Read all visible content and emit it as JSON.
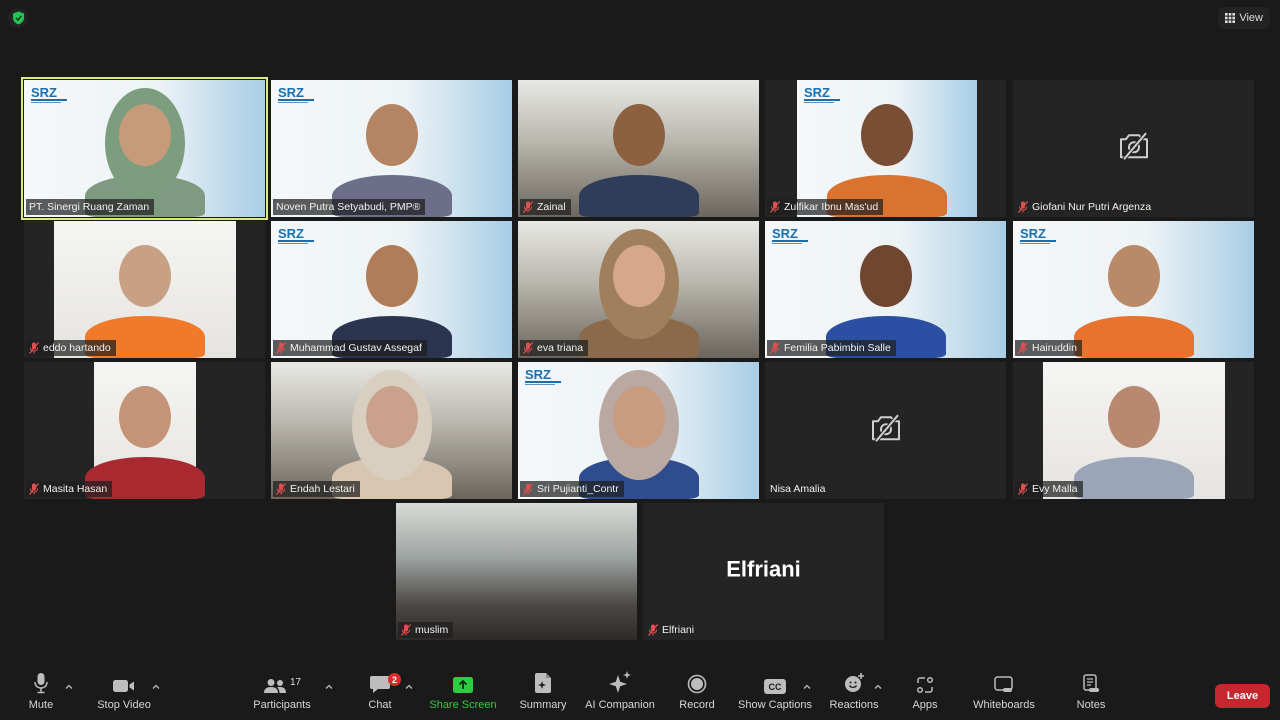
{
  "app": {
    "security_icon": "shield-check-icon",
    "view_button": {
      "label": "View",
      "icon": "grid-icon"
    }
  },
  "colors": {
    "active_speaker_border": "#d9ea7a",
    "muted_mic": "#e05050",
    "share_screen": "#2ecc40",
    "leave": "#c6262e",
    "badge": "#e02a2a"
  },
  "participants": [
    {
      "name": "PT. Sinergi Ruang Zaman",
      "muted": false,
      "video": true,
      "active": true,
      "background": "srz"
    },
    {
      "name": "Noven Putra Setyabudi, PMP®",
      "muted": false,
      "video": true,
      "active": false,
      "background": "srz"
    },
    {
      "name": "Zainal",
      "muted": true,
      "video": true,
      "active": false,
      "background": "office"
    },
    {
      "name": "Zulfikar Ibnu Mas'ud",
      "muted": true,
      "video": true,
      "active": false,
      "background": "srz"
    },
    {
      "name": "Giofani Nur Putri Argenza",
      "muted": true,
      "video": false,
      "active": false,
      "background": "none"
    },
    {
      "name": "eddo hartando",
      "muted": true,
      "video": true,
      "active": false,
      "background": "wall"
    },
    {
      "name": "Muhammad Gustav Assegaf",
      "muted": true,
      "video": true,
      "active": false,
      "background": "srz"
    },
    {
      "name": "eva triana",
      "muted": true,
      "video": true,
      "active": false,
      "background": "office"
    },
    {
      "name": "Femilia Pabimbin Salle",
      "muted": true,
      "video": true,
      "active": false,
      "background": "srz"
    },
    {
      "name": "Hairuddin",
      "muted": true,
      "video": true,
      "active": false,
      "background": "srz"
    },
    {
      "name": "Masita Hasan",
      "muted": true,
      "video": true,
      "active": false,
      "background": "wall"
    },
    {
      "name": "Endah Lestari",
      "muted": true,
      "video": true,
      "active": false,
      "background": "office"
    },
    {
      "name": "Sri Pujianti_Contr",
      "muted": true,
      "video": true,
      "active": false,
      "background": "srz"
    },
    {
      "name": "Nisa Amalia",
      "muted": false,
      "video": false,
      "active": false,
      "background": "none"
    },
    {
      "name": "Evy Malla",
      "muted": true,
      "video": true,
      "active": false,
      "background": "wall"
    },
    {
      "name": "muslim",
      "muted": true,
      "video": true,
      "active": false,
      "background": "lobby"
    },
    {
      "name": "Elfriani",
      "muted": true,
      "video": false,
      "active": false,
      "background": "none",
      "display_name": "Elfriani"
    }
  ],
  "toolbar": {
    "mute": {
      "label": "Mute",
      "icon": "microphone-icon"
    },
    "video": {
      "label": "Stop Video",
      "icon": "video-camera-icon"
    },
    "participants": {
      "label": "Participants",
      "icon": "participants-icon",
      "count": "17"
    },
    "chat": {
      "label": "Chat",
      "icon": "chat-icon",
      "badge": "2"
    },
    "share": {
      "label": "Share Screen",
      "icon": "share-screen-icon"
    },
    "summary": {
      "label": "Summary",
      "icon": "summary-icon"
    },
    "ai": {
      "label": "AI Companion",
      "icon": "sparkle-icon"
    },
    "record": {
      "label": "Record",
      "icon": "record-icon"
    },
    "captions": {
      "label": "Show Captions",
      "icon": "cc-icon",
      "icon_text": "CC"
    },
    "reactions": {
      "label": "Reactions",
      "icon": "emoji-add-icon"
    },
    "apps": {
      "label": "Apps",
      "icon": "apps-icon"
    },
    "whiteboards": {
      "label": "Whiteboards",
      "icon": "whiteboard-icon"
    },
    "notes": {
      "label": "Notes",
      "icon": "notes-icon"
    },
    "leave": {
      "label": "Leave"
    }
  }
}
